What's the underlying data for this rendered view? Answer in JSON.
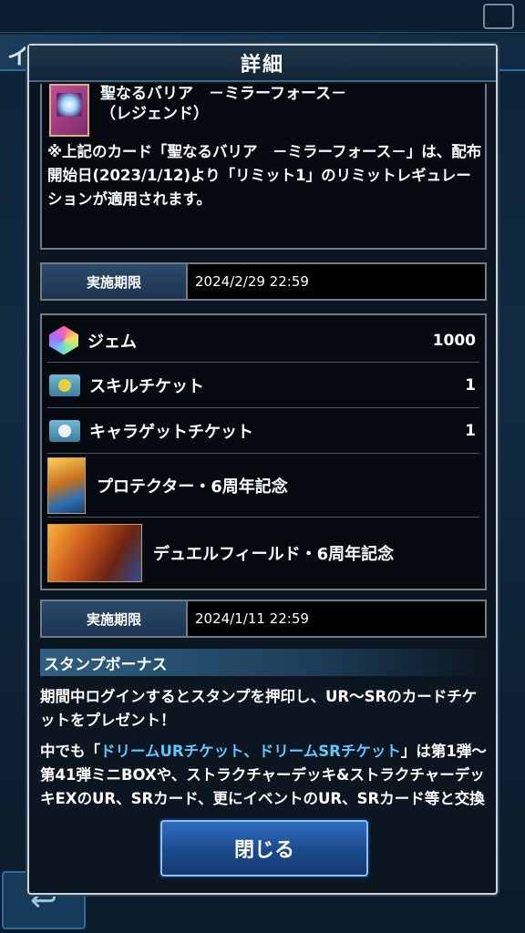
{
  "background": {
    "title_text": "イン"
  },
  "dialog": {
    "title": "詳細",
    "card": {
      "name_line1": "聖なるバリア　－ミラーフォース－",
      "name_line2": "（レジェンド）",
      "note": "※上記のカード「聖なるバリア　－ミラーフォース－」は、配布開始日(2023/1/12)より「リミット1」のリミットレギュレーションが適用されます。"
    },
    "period1": {
      "label": "実施期限",
      "value": "2024/2/29 22:59"
    },
    "rewards": [
      {
        "icon": "gem-icon",
        "label": "ジェム",
        "qty": "1000"
      },
      {
        "icon": "skill-ticket-icon",
        "label": "スキルチケット",
        "qty": "1"
      },
      {
        "icon": "character-ticket-icon",
        "label": "キャラゲットチケット",
        "qty": "1"
      },
      {
        "icon": "card-sleeve-icon",
        "label": "プロテクター・6周年記念",
        "qty": ""
      },
      {
        "icon": "duel-field-icon",
        "label": "デュエルフィールド・6周年記念",
        "qty": ""
      }
    ],
    "period2": {
      "label": "実施期限",
      "value": "2024/1/11 22:59"
    },
    "stamp": {
      "header": "スタンプボーナス",
      "para1": "期間中ログインするとスタンプを押印し、UR～SRのカードチケットをプレゼント！",
      "para2_prefix": "中でも「",
      "para2_highlight": "ドリームURチケット、ドリームSRチケット",
      "para2_suffix": "」は第1弾～第41弾ミニBOXや、ストラクチャーデッキ&ストラクチャーデッキEXのUR、SRカード、更にイベントのUR、SRカード等と交換できる又と無いビッグチャンス！"
    },
    "close_label": "閉じる"
  }
}
